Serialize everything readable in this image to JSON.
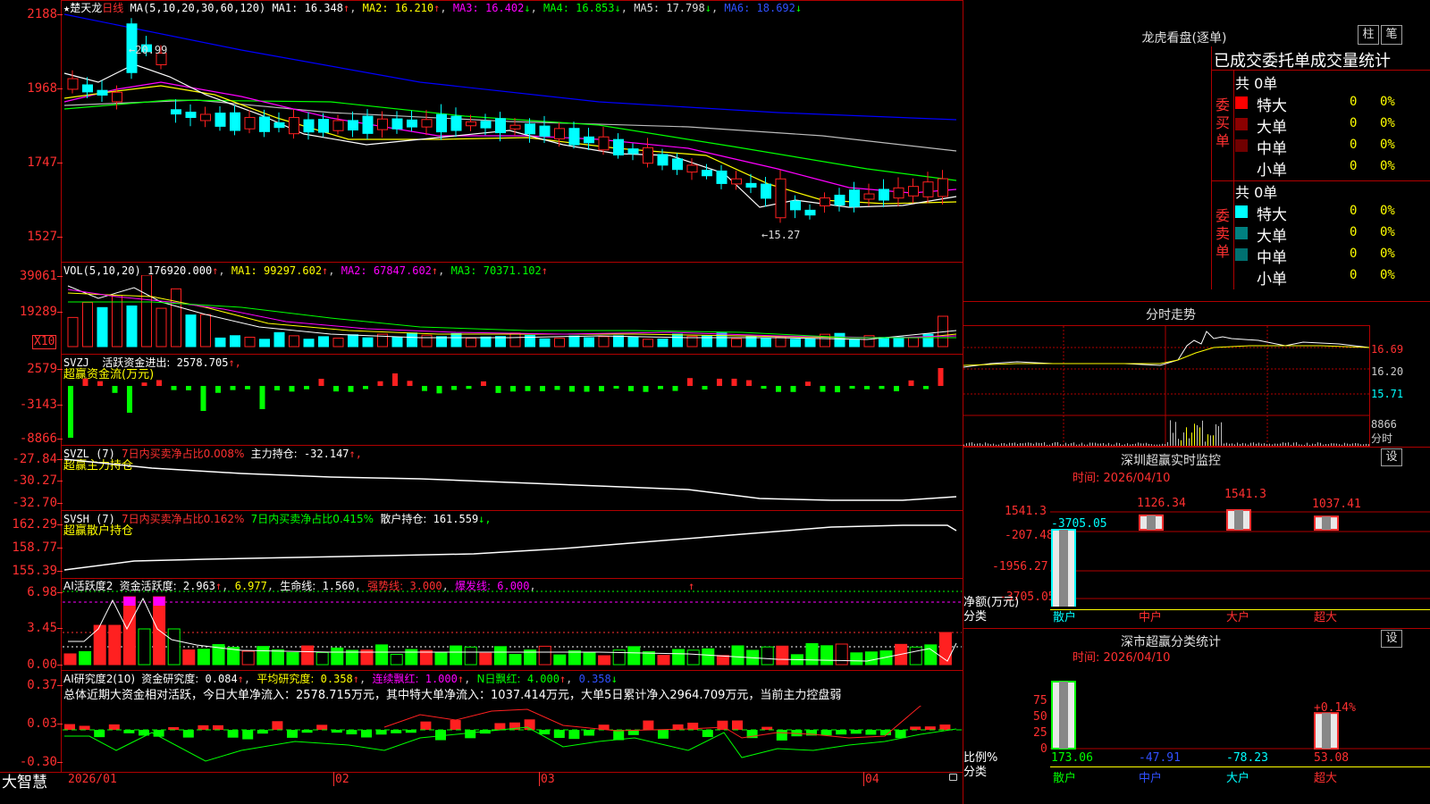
{
  "colors": {
    "bg": "#000000",
    "frame": "#b00000",
    "up": "#ff2020",
    "down": "#00ffff",
    "ma1": "#ffffff",
    "ma2": "#ffff00",
    "ma3": "#ff00ff",
    "ma4": "#00ff00",
    "ma5": "#c0c0c0",
    "ma6": "#0000ff",
    "green": "#00ff00",
    "yellow": "#ffff00",
    "cyan": "#00ffff",
    "magenta": "#ff00ff"
  },
  "main": {
    "star": "★",
    "name": "楚天龙",
    "period": "日线",
    "ma_label": "MA(5,10,20,30,60,120)",
    "ma": [
      {
        "k": "MA1:",
        "v": "16.348",
        "a": "↑"
      },
      {
        "k": "MA2:",
        "v": "16.210",
        "a": "↑"
      },
      {
        "k": "MA3:",
        "v": "16.402",
        "a": "↓"
      },
      {
        "k": "MA4:",
        "v": "16.853",
        "a": "↓"
      },
      {
        "k": "MA5:",
        "v": "17.798",
        "a": "↓"
      },
      {
        "k": "MA6:",
        "v": "18.692",
        "a": "↓"
      }
    ],
    "yticks": [
      "2188",
      "1968",
      "1747",
      "1527"
    ],
    "hi_label": "←20.99",
    "lo_label": "←15.27"
  },
  "vol": {
    "label": "VOL(5,10,20)",
    "v": "176920.000",
    "ma": [
      {
        "k": "MA1:",
        "v": "99297.602"
      },
      {
        "k": "MA2:",
        "v": "67847.602"
      },
      {
        "k": "MA3:",
        "v": "70371.102"
      }
    ],
    "arrow": "↑",
    "yticks": [
      "39061",
      "19289"
    ],
    "unit": "X10"
  },
  "svzj": {
    "label": "SVZJ",
    "k": "活跃资金进出:",
    "v": "2578.705",
    "a": "↑,",
    "sub": "超赢资金流(万元)",
    "yticks": [
      "2579",
      "-3143",
      "-8866"
    ]
  },
  "svzl": {
    "label": "SVZL (7)",
    "k1": "7日内买卖净占比0.008%",
    "k2": "主力持仓:",
    "v": "-32.147",
    "a": "↑,",
    "sub": "超赢主力持仓",
    "yticks": [
      "-27.84",
      "-30.27",
      "-32.70"
    ]
  },
  "svsh": {
    "label": "SVSH (7)",
    "k1": "7日内买卖净占比0.162%",
    "k2": "7日内买卖净占比0.415%",
    "k3": "散户持仓:",
    "v": "161.559",
    "a": "↓,",
    "sub": "超赢散户持仓",
    "yticks": [
      "162.29",
      "158.77",
      "155.39"
    ]
  },
  "ai1": {
    "label": "AI活跃度2",
    "k1": "资金活跃度:",
    "v1": "2.963",
    "a1": "↑",
    "v2": "6.977",
    "k3": "生命线:",
    "v3": "1.560",
    "k4": "强势线:",
    "v4": "3.000",
    "k5": "爆发线:",
    "v5": "6.000",
    "a6": "↑",
    "yticks": [
      "6.98",
      "3.45",
      "0.00"
    ]
  },
  "ai2": {
    "label": "AI研究度2(10)",
    "k1": "资金研究度:",
    "v1": "0.084",
    "a1": "↑",
    "k2": "平均研究度:",
    "v2": "0.358",
    "a2": "↑",
    "k3": "连续飘红:",
    "v3": "1.000",
    "a3": "↑",
    "k4": "N日飘红:",
    "v4": "4.000",
    "a4": "↑",
    "v5": "0.358",
    "a5": "↓",
    "note": "总体近期大资金相对活跃，今日大单净流入：2578.715万元，其中特大单净流入：1037.414万元，大单5日累计净入2964.709万元，当前主力控盘弱",
    "yticks": [
      "0.37",
      "0.03",
      "-0.30"
    ]
  },
  "xaxis": {
    "labels": [
      "2026/01",
      "02",
      "03",
      "04"
    ]
  },
  "brand": "大智慧",
  "right": {
    "dragon_title": "龙虎看盘(逐单)",
    "btn_zhu": "柱",
    "btn_bi": "笔",
    "table_title": "已成交委托单成交量统计",
    "buy_side": "委买单",
    "sell_side": "委卖单",
    "buy_total": "共 0单",
    "sell_total": "共 0单",
    "rows": [
      {
        "name": "特大",
        "n": "0",
        "p": "0%"
      },
      {
        "name": "大单",
        "n": "0",
        "p": "0%"
      },
      {
        "name": "中单",
        "n": "0",
        "p": "0%"
      },
      {
        "name": "小单",
        "n": "0",
        "p": "0%"
      }
    ],
    "buy_colors": [
      "#ff0000",
      "#8b0000",
      "#7a0000",
      ""
    ],
    "sell_colors": [
      "#00ffff",
      "#008080",
      "#008080",
      ""
    ],
    "intraday_title": "分时走势",
    "intraday_y": [
      "16.69",
      "16.20",
      "15.71"
    ],
    "intraday_vol": "8866",
    "intraday_unit": "分时",
    "sz_title": "深圳超赢实时监控",
    "sz_btn": "设",
    "sz_time": "时间: 2026/04/10",
    "sz_yticks": [
      "1541.3",
      "-207.48",
      "-1956.27",
      "-3705.05"
    ],
    "sz_net_label": "净额(万元)",
    "sz_cat_label": "分类",
    "sz_cats": [
      "散户",
      "中户",
      "大户",
      "超大"
    ],
    "sz_values": [
      -3705.05,
      1126.34,
      1541.3,
      1037.41
    ],
    "sz_value_labels": [
      "-3705.05",
      "1126.34",
      "1541.3",
      "1037.41"
    ],
    "cls_title": "深市超赢分类统计",
    "cls_btn": "设",
    "cls_time": "时间: 2026/04/10",
    "cls_yticks": [
      "75",
      "50",
      "25",
      "0"
    ],
    "cls_plus": "+0.14%",
    "cls_ratio_label": "比例%",
    "cls_cat_label": "分类",
    "cls_values": [
      173.06,
      -47.91,
      -78.23,
      53.08
    ],
    "cls_value_labels": [
      "173.06",
      "-47.91",
      "-78.23",
      "53.08"
    ],
    "cls_cats": [
      "散户",
      "中户",
      "大户",
      "超大"
    ]
  }
}
